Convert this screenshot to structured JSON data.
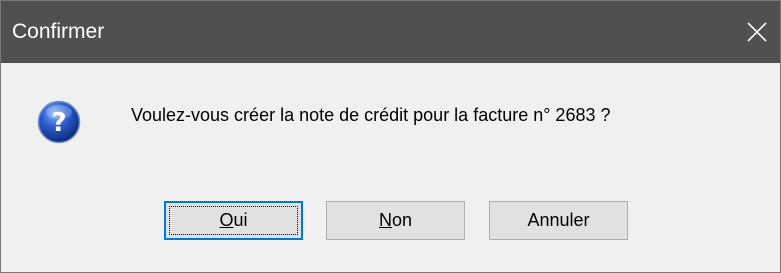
{
  "window": {
    "title": "Confirmer",
    "titlebar_color": "#505050",
    "accent_color": "#0078d7"
  },
  "dialog": {
    "icon": "question-icon",
    "message": "Voulez-vous créer la note de crédit pour la facture n° 2683 ?"
  },
  "buttons": [
    {
      "mnemonic": "O",
      "rest": "ui",
      "label": "Oui",
      "is_default": true
    },
    {
      "mnemonic": "N",
      "rest": "on",
      "label": "Non",
      "is_default": false
    },
    {
      "label": "Annuler",
      "is_default": false
    }
  ]
}
